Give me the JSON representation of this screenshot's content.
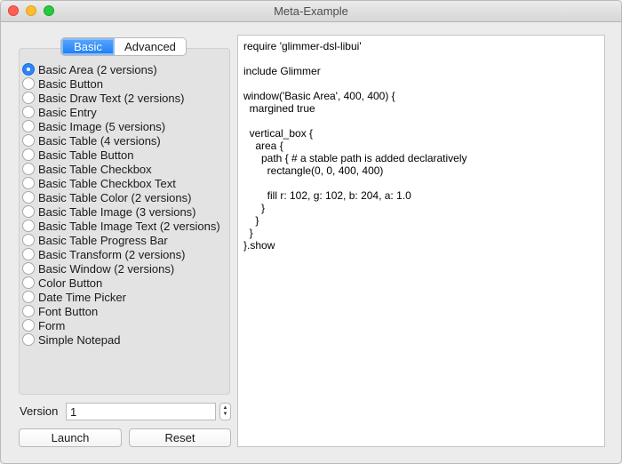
{
  "window": {
    "title": "Meta-Example"
  },
  "tabs": {
    "basic_label": "Basic",
    "advanced_label": "Advanced"
  },
  "examples": [
    {
      "label": "Basic Area (2 versions)",
      "selected": true
    },
    {
      "label": "Basic Button",
      "selected": false
    },
    {
      "label": "Basic Draw Text (2 versions)",
      "selected": false
    },
    {
      "label": "Basic Entry",
      "selected": false
    },
    {
      "label": "Basic Image (5 versions)",
      "selected": false
    },
    {
      "label": "Basic Table (4 versions)",
      "selected": false
    },
    {
      "label": "Basic Table Button",
      "selected": false
    },
    {
      "label": "Basic Table Checkbox",
      "selected": false
    },
    {
      "label": "Basic Table Checkbox Text",
      "selected": false
    },
    {
      "label": "Basic Table Color (2 versions)",
      "selected": false
    },
    {
      "label": "Basic Table Image (3 versions)",
      "selected": false
    },
    {
      "label": "Basic Table Image Text (2 versions)",
      "selected": false
    },
    {
      "label": "Basic Table Progress Bar",
      "selected": false
    },
    {
      "label": "Basic Transform (2 versions)",
      "selected": false
    },
    {
      "label": "Basic Window (2 versions)",
      "selected": false
    },
    {
      "label": "Color Button",
      "selected": false
    },
    {
      "label": "Date Time Picker",
      "selected": false
    },
    {
      "label": "Font Button",
      "selected": false
    },
    {
      "label": "Form",
      "selected": false
    },
    {
      "label": "Simple Notepad",
      "selected": false
    }
  ],
  "version": {
    "label": "Version",
    "value": "1"
  },
  "buttons": {
    "launch": "Launch",
    "reset": "Reset"
  },
  "code": "require 'glimmer-dsl-libui'\n\ninclude Glimmer\n\nwindow('Basic Area', 400, 400) {\n  margined true\n\n  vertical_box {\n    area {\n      path { # a stable path is added declaratively\n        rectangle(0, 0, 400, 400)\n\n        fill r: 102, g: 102, b: 204, a: 1.0\n      }\n    }\n  }\n}.show",
  "colors": {
    "accent": "#2c84f7",
    "window_bg": "#ececec"
  }
}
